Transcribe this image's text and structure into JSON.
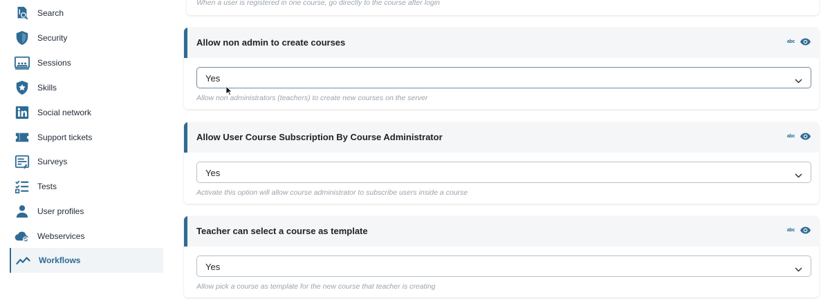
{
  "sidebar": {
    "items": [
      {
        "label": "Search",
        "icon": "search-icon"
      },
      {
        "label": "Security",
        "icon": "shield-icon"
      },
      {
        "label": "Sessions",
        "icon": "sessions-icon"
      },
      {
        "label": "Skills",
        "icon": "star-shield-icon"
      },
      {
        "label": "Social network",
        "icon": "linkedin-icon"
      },
      {
        "label": "Support tickets",
        "icon": "ticket-icon"
      },
      {
        "label": "Surveys",
        "icon": "survey-icon"
      },
      {
        "label": "Tests",
        "icon": "checklist-icon"
      },
      {
        "label": "User profiles",
        "icon": "user-icon"
      },
      {
        "label": "Webservices",
        "icon": "cloud-sync-icon"
      },
      {
        "label": "Workflows",
        "icon": "trend-line-icon",
        "active": true
      }
    ]
  },
  "top_card": {
    "description": "When a user is registered in one course, go directly to the course after login"
  },
  "settings": [
    {
      "title": "Allow non admin to create courses",
      "value": "Yes",
      "description": "Allow non administrators (teachers) to create new courses on the server"
    },
    {
      "title": "Allow User Course Subscription By Course Administrator",
      "value": "Yes",
      "description": "Activate this option will allow course administrator to subscribe users inside a course"
    },
    {
      "title": "Teacher can select a course as template",
      "value": "Yes",
      "description": "Allow pick a course as template for the new course that teacher is creating"
    }
  ],
  "header_icons": {
    "abc": "abc",
    "eye": "eye-icon"
  },
  "colors": {
    "accent": "#2f6b94",
    "header_bg": "#f5f6f8",
    "active_bg": "#f1f4f7"
  }
}
